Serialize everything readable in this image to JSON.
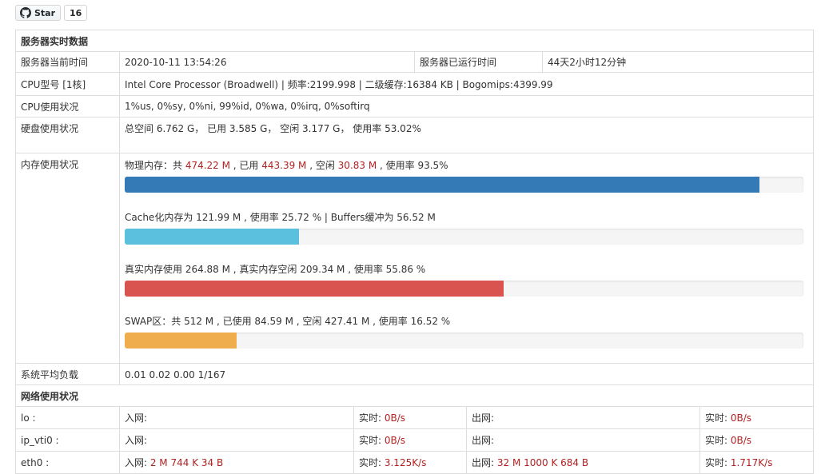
{
  "github": {
    "star_label": "Star",
    "star_count": "16"
  },
  "realtime": {
    "title": "服务器实时数据",
    "time_label": "服务器当前时间",
    "time_value": "2020-10-11 13:54:26",
    "uptime_label": "服务器已运行时间",
    "uptime_value": "44天2小时12分钟",
    "cpu_model_label": "CPU型号 [1核]",
    "cpu_model_value": "Intel Core Processor (Broadwell) | 频率:2199.998 | 二级缓存:16384 KB | Bogomips:4399.99",
    "cpu_usage_label": "CPU使用状况",
    "cpu_usage_value": "1%us, 0%sy, 0%ni, 99%id, 0%wa, 0%irq, 0%softirq",
    "disk_label": "硬盘使用状况",
    "disk_value": "总空间 6.762 G， 已用 3.585 G， 空闲 3.177 G， 使用率 53.02%",
    "memory_label": "内存使用状况",
    "memory": {
      "physical": {
        "prefix": "物理内存：共 ",
        "total": "474.22 M",
        "used_prefix": " , 已用 ",
        "used": "443.39 M",
        "free_prefix": " , 空闲 ",
        "free": "30.83 M",
        "suffix": " , 使用率 93.5%",
        "percent": 93.5,
        "color": "#337ab7"
      },
      "cache": {
        "text": "Cache化内存为 121.99 M , 使用率 25.72 % | Buffers缓冲为 56.52 M",
        "percent": 25.72,
        "color": "#5bc0de"
      },
      "real": {
        "text": "真实内存使用 264.88 M , 真实内存空闲 209.34 M , 使用率 55.86 %",
        "percent": 55.86,
        "color": "#d9534f"
      },
      "swap": {
        "text": "SWAP区：共 512 M , 已使用 84.59 M , 空闲 427.41 M , 使用率 16.52 %",
        "percent": 16.52,
        "color": "#f0ad4e"
      }
    },
    "load_label": "系统平均负载",
    "load_value": "0.01 0.02 0.00 1/167"
  },
  "network": {
    "title": "网络使用状况",
    "rows": [
      {
        "iface": "lo :",
        "in_label": "入网:",
        "in_value": "",
        "rt_label": "实时: ",
        "rt_in": "0B/s",
        "out_label": "出网:",
        "out_value": "",
        "rt2_label": "实时: ",
        "rt_out": "0B/s"
      },
      {
        "iface": "ip_vti0 :",
        "in_label": "入网:",
        "in_value": "",
        "rt_label": "实时: ",
        "rt_in": "0B/s",
        "out_label": "出网:",
        "out_value": "",
        "rt2_label": "实时: ",
        "rt_out": "0B/s"
      },
      {
        "iface": "eth0 :",
        "in_label": "入网: ",
        "in_value": "2 M 744 K 34 B",
        "rt_label": "实时: ",
        "rt_in": "3.125K/s",
        "out_label": "出网: ",
        "out_value": "32 M 1000 K 684 B",
        "rt2_label": "实时: ",
        "rt_out": "1.717K/s"
      }
    ]
  }
}
